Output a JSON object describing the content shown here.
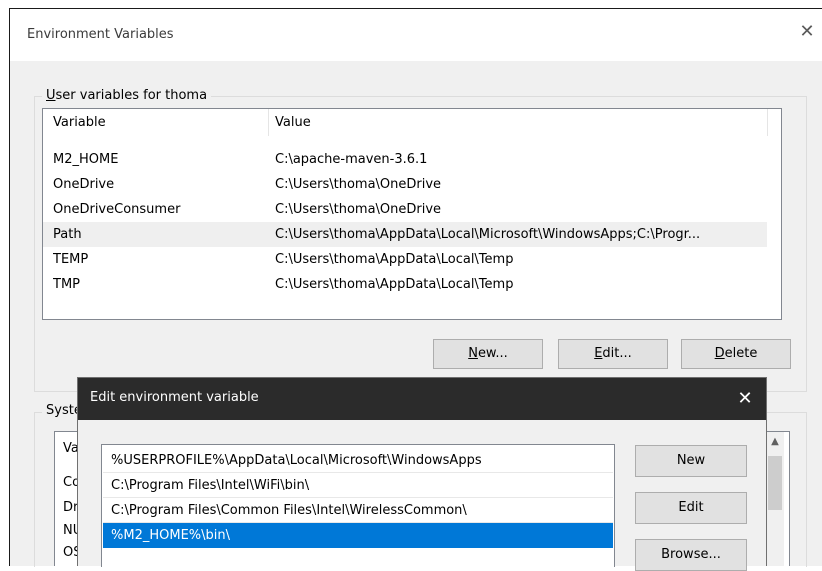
{
  "outer_dialog": {
    "title": "Environment Variables",
    "close_glyph": "✕",
    "user_group": {
      "label_underlined": "U",
      "label_rest": "ser variables for thoma",
      "columns": [
        "Variable",
        "Value"
      ],
      "rows": [
        {
          "variable": "M2_HOME",
          "value": "C:\\apache-maven-3.6.1"
        },
        {
          "variable": "OneDrive",
          "value": "C:\\Users\\thoma\\OneDrive"
        },
        {
          "variable": "OneDriveConsumer",
          "value": "C:\\Users\\thoma\\OneDrive"
        },
        {
          "variable": "Path",
          "value": "C:\\Users\\thoma\\AppData\\Local\\Microsoft\\WindowsApps;C:\\Progr..."
        },
        {
          "variable": "TEMP",
          "value": "C:\\Users\\thoma\\AppData\\Local\\Temp"
        },
        {
          "variable": "TMP",
          "value": "C:\\Users\\thoma\\AppData\\Local\\Temp"
        }
      ],
      "selected_row": 3,
      "buttons": {
        "new": {
          "underlined": "N",
          "rest": "ew..."
        },
        "edit": {
          "underlined": "E",
          "rest": "dit..."
        },
        "delete": {
          "underlined": "D",
          "rest": "elete"
        }
      }
    },
    "system_group": {
      "label_partial": "Syste",
      "visible_cells": [
        "Va",
        "Co",
        "Dr",
        "NU",
        "OS"
      ]
    }
  },
  "edit_dialog": {
    "title": "Edit environment variable",
    "close_glyph": "✕",
    "entries": [
      "%USERPROFILE%\\AppData\\Local\\Microsoft\\WindowsApps",
      "C:\\Program Files\\Intel\\WiFi\\bin\\",
      "C:\\Program Files\\Common Files\\Intel\\WirelessCommon\\",
      "%M2_HOME%\\bin\\"
    ],
    "selected_entry": 3,
    "buttons": {
      "new": "New",
      "edit": "Edit",
      "browse": "Browse..."
    }
  },
  "colors": {
    "selection_blue": "#0078d7",
    "inner_titlebar": "#2b2b2b"
  }
}
